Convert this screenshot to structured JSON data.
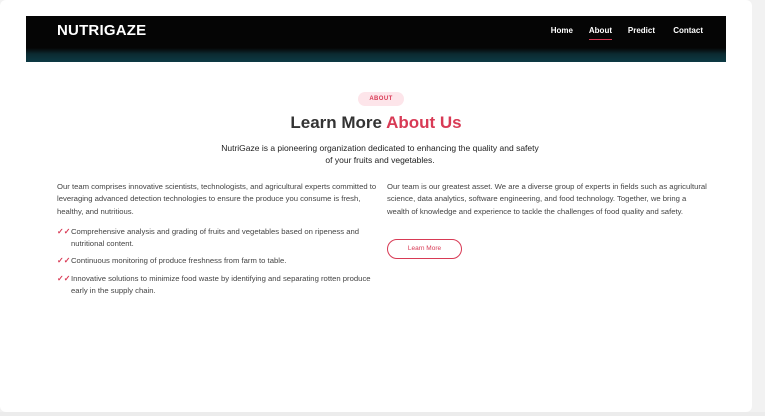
{
  "header": {
    "brand": "NUTRIGAZE",
    "nav": [
      {
        "label": "Home"
      },
      {
        "label": "About"
      },
      {
        "label": "Predict"
      },
      {
        "label": "Contact"
      }
    ]
  },
  "about": {
    "badge": "ABOUT",
    "heading_prefix": "Learn More ",
    "heading_accent": "About Us",
    "lead": "NutriGaze is a pioneering organization dedicated to enhancing the quality and safety of your fruits and vegetables.",
    "left_paragraph": "Our team comprises innovative scientists, technologists, and agricultural experts committed to leveraging advanced detection technologies to ensure the produce you consume is fresh, healthy, and nutritious.",
    "features": [
      "Comprehensive analysis and grading of fruits and vegetables based on ripeness and nutritional content.",
      "Continuous monitoring of produce freshness from farm to table.",
      "Innovative solutions to minimize food waste by identifying and separating rotten produce early in the supply chain."
    ],
    "right_paragraph": "Our team is our greatest asset. We are a diverse group of experts in fields such as agricultural science, data analytics, software engineering, and food technology. Together, we bring a wealth of knowledge and experience to tackle the challenges of food quality and safety.",
    "learn_more_label": "Learn More"
  },
  "colors": {
    "accent": "#d83a55",
    "header_bg": "#050505",
    "badge_bg": "#fde5ea"
  },
  "icons": {
    "feature_bullet": "double-check-icon"
  }
}
